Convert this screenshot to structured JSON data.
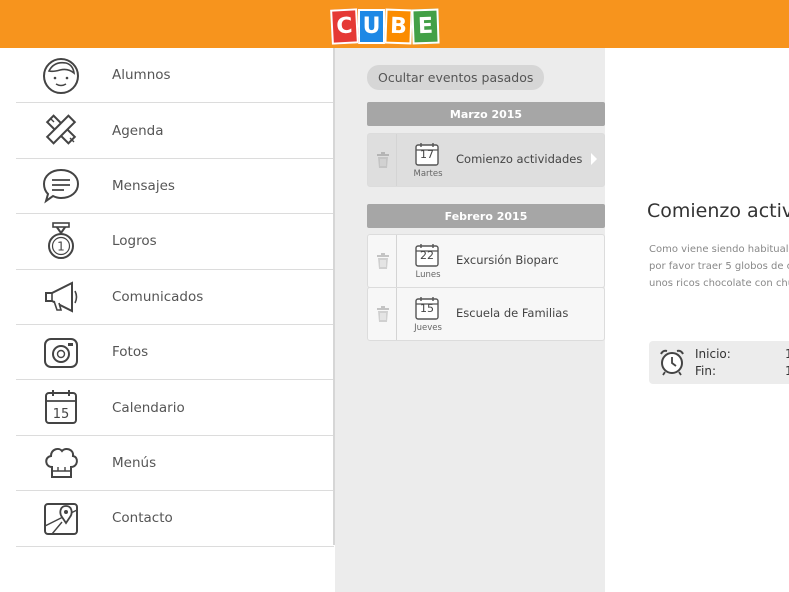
{
  "header": {
    "logo_letters": [
      "C",
      "U",
      "B",
      "E"
    ],
    "logo_colors": [
      "#e53935",
      "#1e88e5",
      "#fb8c00",
      "#43a047"
    ],
    "bar_color": "#f7941d"
  },
  "sidebar": {
    "items": [
      {
        "label": "Alumnos",
        "icon": "student-face-icon"
      },
      {
        "label": "Agenda",
        "icon": "pencil-ruler-icon"
      },
      {
        "label": "Mensajes",
        "icon": "chat-bubble-icon"
      },
      {
        "label": "Logros",
        "icon": "medal-icon"
      },
      {
        "label": "Comunicados",
        "icon": "megaphone-icon"
      },
      {
        "label": "Fotos",
        "icon": "camera-icon"
      },
      {
        "label": "Calendario",
        "icon": "calendar-icon"
      },
      {
        "label": "Menús",
        "icon": "chef-hat-icon"
      },
      {
        "label": "Contacto",
        "icon": "map-pin-icon"
      }
    ],
    "calendar_icon_number": "15",
    "medal_icon_number": "1"
  },
  "events": {
    "toggle_label": "Ocultar eventos pasados",
    "months": [
      {
        "label": "Marzo 2015",
        "events": [
          {
            "day_number": "17",
            "weekday": "Martes",
            "title": "Comienzo actividades",
            "selected": true
          }
        ]
      },
      {
        "label": "Febrero 2015",
        "events": [
          {
            "day_number": "22",
            "weekday": "Lunes",
            "title": "Excursión Bioparc",
            "selected": false
          },
          {
            "day_number": "15",
            "weekday": "Jueves",
            "title": "Escuela de Familias",
            "selected": false
          }
        ]
      }
    ]
  },
  "detail": {
    "title": "Comienzo activ",
    "description_lines": [
      "Como viene siendo habitual",
      "por favor traer 5 globos de c",
      "unos ricos chocolate con chu"
    ],
    "start_label": "Inicio:",
    "start_value": "1",
    "end_label": "Fin:",
    "end_value": "1"
  }
}
